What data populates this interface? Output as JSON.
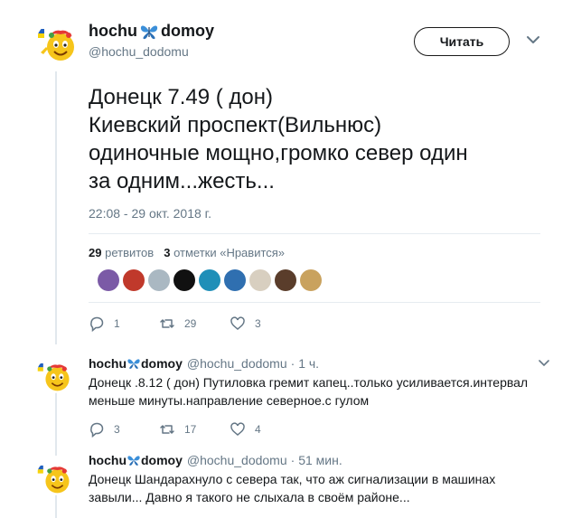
{
  "profile": {
    "name_part1": "hochu",
    "name_part2": "domoy",
    "handle": "@hochu_dodomu",
    "follow_label": "Читать"
  },
  "tweet": {
    "text": "Донецк 7.49 ( дон)\nКиевский проспект(Вильнюс)\nодиночные мощно,громко  север один\nза одним...жесть...",
    "timestamp": "22:08 - 29 окт. 2018 г.",
    "retweets_count": "29",
    "retweets_label": "ретвитов",
    "likes_count": "3",
    "likes_label": "отметки «Нравится»",
    "likers": [
      "#7b5aa6",
      "#c0392b",
      "#aab8c2",
      "#111111",
      "#1f8fb8",
      "#2f6fb0",
      "#d8cfc0",
      "#5a3d2b",
      "#c9a25e"
    ],
    "actions": {
      "reply_count": "1",
      "retweet_count": "29",
      "like_count": "3"
    }
  },
  "replies": [
    {
      "name_part1": "hochu",
      "name_part2": "domoy",
      "handle": "@hochu_dodomu",
      "time": "· 1 ч.",
      "text": "Донецк  .8.12 ( дон)  Путиловка гремит капец..только усиливается.интервал меньше минуты.направление северное.с гулом",
      "actions": {
        "reply_count": "3",
        "retweet_count": "17",
        "like_count": "4"
      }
    },
    {
      "name_part1": "hochu",
      "name_part2": "domoy",
      "handle": "@hochu_dodomu",
      "time": "· 51 мин.",
      "text": "Донецк Шандарахнуло с севера так, что аж сигнализации в машинах завыли... Давно я такого не слыхала в своём районе..."
    }
  ],
  "colors": {
    "accent": "#1da1f2",
    "muted": "#657786",
    "text": "#14171a",
    "butterfly": "#3b8fd9"
  }
}
